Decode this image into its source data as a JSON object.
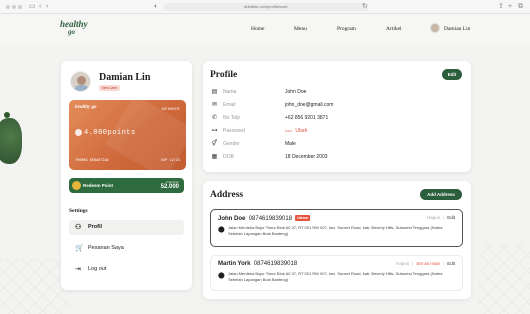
{
  "browser": {
    "url": "dribbble.com/profile/user"
  },
  "header": {
    "logo_top": "healthy",
    "logo_bottom": "go",
    "nav": [
      "Home",
      "Menu",
      "Program",
      "Artikel"
    ],
    "user_name": "Damian Lin"
  },
  "sidebar": {
    "name": "Damian Lin",
    "badge": "New User",
    "membership": {
      "brand": "healthy go",
      "label": "MEMBER",
      "points": "4.000points",
      "holder": "THOMAS SEBASTIAN",
      "exp": "EXP 12/23"
    },
    "redeem": {
      "label": "Redeem Point",
      "points_caption": "Total Point",
      "points": "52.000"
    },
    "settings_title": "Settings",
    "menu": [
      {
        "label": "Profil",
        "icon": "user-icon"
      },
      {
        "label": "Pesanan Saya",
        "icon": "cart-icon"
      },
      {
        "label": "Log out",
        "icon": "logout-icon"
      }
    ]
  },
  "profile": {
    "title": "Profile",
    "edit_label": "Edit",
    "fields": [
      {
        "label": "Nama",
        "value": "John Doe",
        "icon": "id-card-icon"
      },
      {
        "label": "Email",
        "value": "john_doe@gmail.com",
        "icon": "mail-icon"
      },
      {
        "label": "No Telp",
        "value": "+62  856 9201 3871",
        "icon": "phone-icon"
      },
      {
        "label": "Password",
        "value": "•••••",
        "icon": "key-icon",
        "action": "Ubah"
      },
      {
        "label": "Gender",
        "value": "Male",
        "icon": "gender-icon"
      },
      {
        "label": "DOB",
        "value": "18 December 2003",
        "icon": "calendar-icon"
      }
    ]
  },
  "address": {
    "title": "Address",
    "add_label": "Add Address",
    "items": [
      {
        "name": "John Doe",
        "phone": "0874619839018",
        "tag": "Utama",
        "text": "Jalan Merdeka Bujur Timur Blok A0 37, RT 001 RW 007, kec. Sunset Road, kab. Beverly Hills, Sulawesi Tenggara (Notes: Sebelah Lapangan Bola Banteng)",
        "actions": [
          "Hapus",
          "Edit"
        ]
      },
      {
        "name": "Martin York",
        "phone": "0874619839018",
        "text": "Jalan Merdeka Bujur Timur Blok A0 37, RT 001 RW 007, kec. Sunset Road, kab. Beverly Hills, Sulawesi Tenggara (Notes: Sebelah Lapangan Bola Banteng)",
        "actions": [
          "Hapus",
          "Set as main",
          "Edit"
        ]
      }
    ]
  },
  "colors": {
    "brand_green": "#2b5e3d",
    "accent_red": "#e5533d",
    "card_orange": "#d06a3c"
  }
}
